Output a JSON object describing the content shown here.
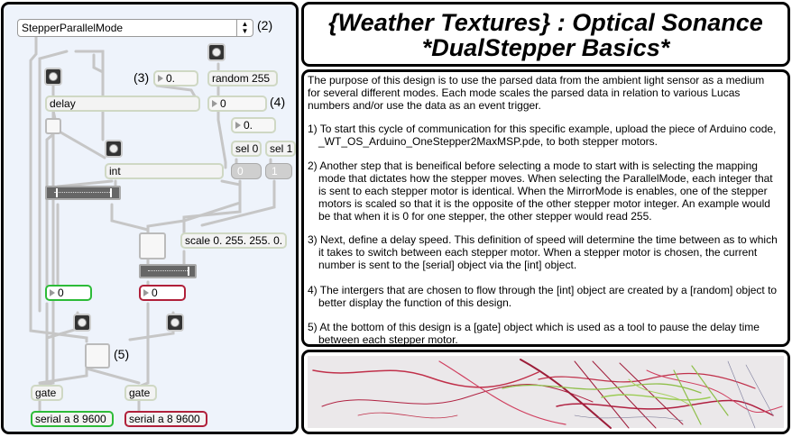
{
  "patcher": {
    "mode_menu": {
      "selected": "StepperParallelMode"
    },
    "callouts": {
      "c2": "(2)",
      "c3": "(3)",
      "c4": "(4)",
      "c5": "(5)"
    },
    "objects": {
      "delay": "delay",
      "random": "random 255",
      "int": "int",
      "sel0": "sel 0",
      "sel1": "sel 1",
      "scale": "scale 0. 255. 255. 0.",
      "gate_left": "gate",
      "gate_right": "gate",
      "serial_left": "serial a 8 9600",
      "serial_right": "serial a 8 9600"
    },
    "numbers": {
      "delay_time": "0.",
      "random_out": "0",
      "float_box": "0.",
      "left_out": "0",
      "right_out": "0"
    },
    "messages": {
      "msg0": "0",
      "msg1": "1"
    },
    "colors": {
      "left_stepper": "#2dbb38",
      "right_stepper": "#b0203a"
    }
  },
  "header": {
    "title_line1": "{Weather Textures} : Optical Sonance",
    "title_line2": "*DualStepper Basics*"
  },
  "description": {
    "intro": "The purpose of this design is to use the parsed data from the ambient light sensor as a medium for several different modes. Each mode scales the parsed data in relation to various Lucas numbers and/or use the data as an event trigger.",
    "steps": [
      "1) To start this cycle of communication for this specific example, upload the piece of Arduino code, _WT_OS_Arduino_OneStepper2MaxMSP.pde, to both stepper motors.",
      "2) Another step that is beneifical before selecting a mode to start with is selecting the mapping mode that dictates how the stepper moves. When selecting the ParallelMode, each integer that is sent to each stepper motor is identical. When the MirrorMode is enables, one of the stepper motors is scaled so that it is the opposite of the other stepper motor integer. An example would be that when it is 0 for one stepper, the other stepper would read 255.",
      "3) Next, define a delay speed. This definition of speed will determine the time between as to which it takes to switch between each stepper motor. When a stepper motor is chosen, the current number is sent to the [serial] object via the [int] object.",
      "4) The intergers that are chosen to flow through the [int] object are created by a [random] object to better display the function of this design.",
      "5) At the bottom of this design is a [gate] object which is used as a tool to pause the delay time between each stepper motor."
    ]
  }
}
